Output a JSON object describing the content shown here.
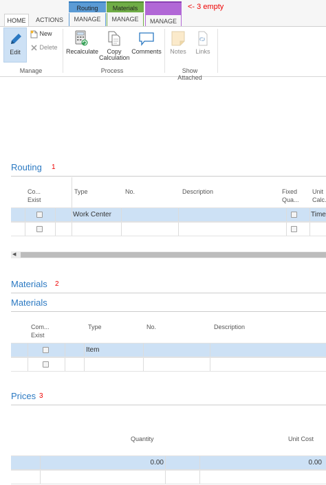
{
  "ribbon": {
    "tabs": [
      "HOME",
      "ACTIONS"
    ],
    "context_groups": [
      {
        "label": "Routing",
        "tab": "MANAGE",
        "color": "#5b9bd5"
      },
      {
        "label": "Materials",
        "tab": "MANAGE",
        "color": "#70ad47"
      },
      {
        "label": "",
        "tab": "MANAGE",
        "color": "#b167d6"
      }
    ],
    "annotation": "<- 3 empty",
    "manage": {
      "edit": "Edit",
      "new": "New",
      "delete": "Delete",
      "group": "Manage"
    },
    "process": {
      "recalculate": "Recalculate",
      "copy_line1": "Copy",
      "copy_line2": "Calculation",
      "comments": "Comments",
      "group": "Process"
    },
    "show_attached": {
      "notes": "Notes",
      "links": "Links",
      "group": "Show Attached"
    }
  },
  "routing": {
    "title": "Routing",
    "number": "1",
    "columns": {
      "comments_line1": "Co...",
      "comments_line2": "Exist",
      "type": "Type",
      "no": "No.",
      "description": "Description",
      "fixed_line1": "Fixed",
      "fixed_line2": "Qua...",
      "unit_line1": "Unit",
      "unit_line2": "Calc..."
    },
    "rows": [
      {
        "type": "Work Center",
        "unit": "Time"
      },
      {
        "type": "",
        "unit": ""
      }
    ]
  },
  "materials": {
    "title": "Materials",
    "number": "2",
    "subtitle": "Materials",
    "columns": {
      "comments_line1": "Com...",
      "comments_line2": "Exist",
      "type": "Type",
      "no": "No.",
      "description": "Description"
    },
    "rows": [
      {
        "type": "Item"
      },
      {
        "type": ""
      }
    ]
  },
  "prices": {
    "title": "Prices",
    "number": "3",
    "columns": {
      "quantity": "Quantity",
      "unit_cost": "Unit Cost"
    },
    "rows": [
      {
        "quantity": "0.00",
        "unit_cost": "0.00"
      },
      {
        "quantity": "",
        "unit_cost": ""
      }
    ]
  },
  "colors": {
    "accent": "#2b79c2",
    "selected_row": "#cde1f5",
    "annotation": "#ee0000"
  }
}
